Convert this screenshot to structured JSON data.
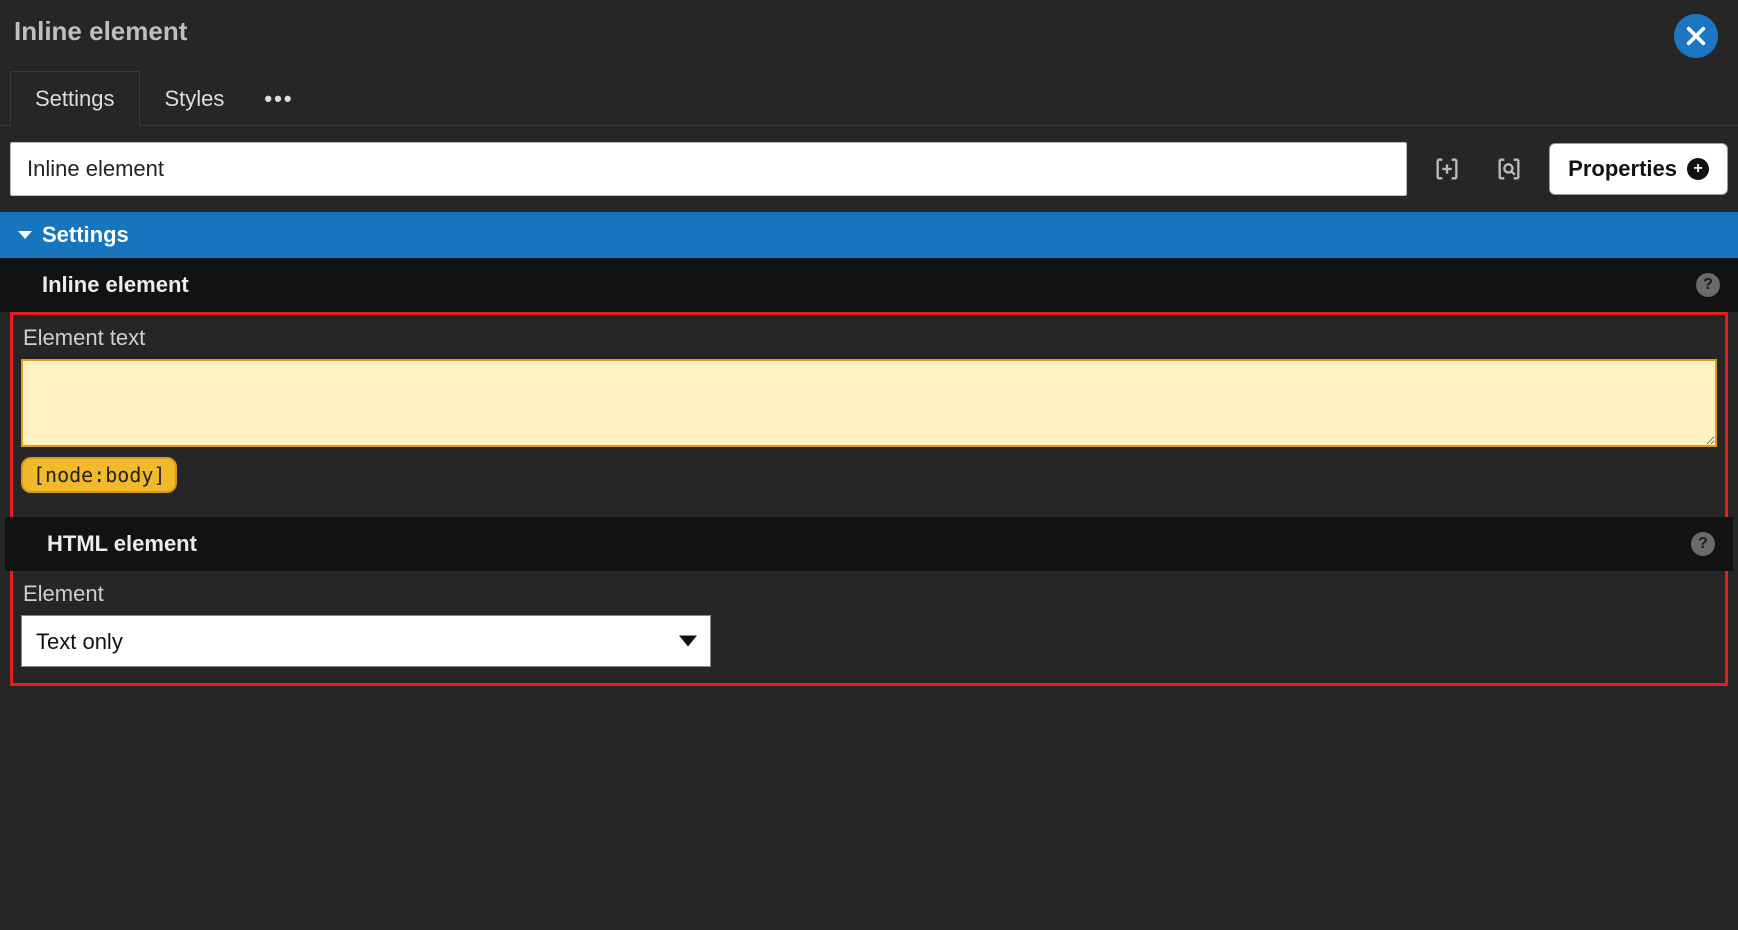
{
  "header": {
    "title": "Inline element"
  },
  "tabs": {
    "settings": "Settings",
    "styles": "Styles",
    "more": "•••"
  },
  "toolbar": {
    "title_value": "Inline element",
    "properties_label": "Properties"
  },
  "section": {
    "settings_label": "Settings"
  },
  "inline_element": {
    "header": "Inline element",
    "element_text_label": "Element text",
    "element_text_value": "",
    "token_chip": "[node:body]"
  },
  "html_element": {
    "header": "HTML element",
    "element_label": "Element",
    "element_value": "Text only"
  }
}
